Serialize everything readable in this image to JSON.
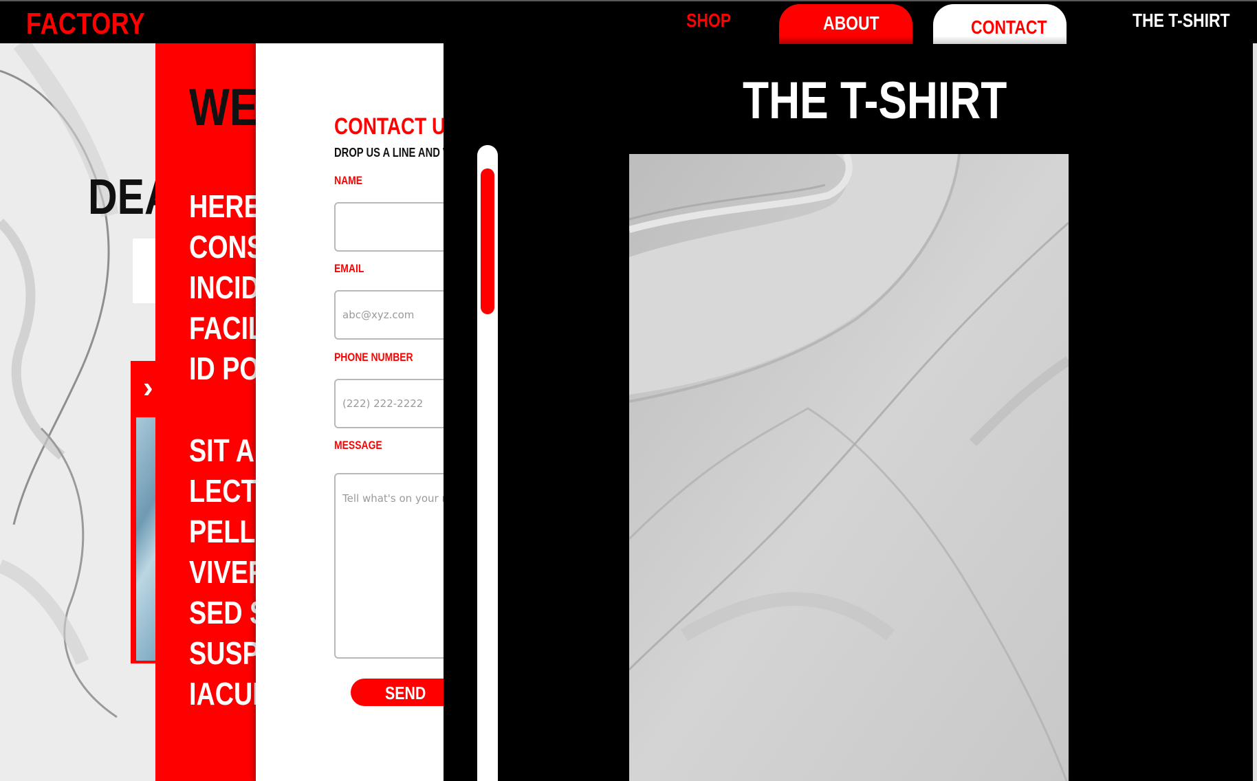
{
  "nav": {
    "logo": "FACTORY",
    "shop": "SHOP",
    "about": "ABOUT",
    "contact": "CONTACT",
    "tshirt": "THE T-SHIRT"
  },
  "background_page": {
    "heading": "DEA"
  },
  "red_panel": {
    "welcome": "WEL",
    "lines": [
      "HERE I",
      "CONSE",
      "INCIDI",
      "FACILI",
      "ID POR",
      "SIT AM",
      "LECTU",
      "PELLE",
      "VIVERI",
      "SED SI",
      "SUSPE",
      " IACUL"
    ]
  },
  "contact_form": {
    "title": "CONTACT US",
    "subtitle": "DROP US A LINE AND WE'L",
    "name_label": "NAME",
    "name_value": "",
    "email_label": "EMAIL",
    "email_placeholder": "abc@xyz.com",
    "phone_label": "PHONE NUMBER",
    "phone_placeholder": "(222) 222-2222",
    "message_label": "MESSAGE",
    "message_placeholder": "Tell what's on your m",
    "send_label": "SEND"
  },
  "lightbox": {
    "title": "THE T-SHIRT",
    "image_icon": "tshirt-photo"
  },
  "colors": {
    "accent": "#ff0000",
    "background": "#000000",
    "text_light": "#ffffff"
  }
}
